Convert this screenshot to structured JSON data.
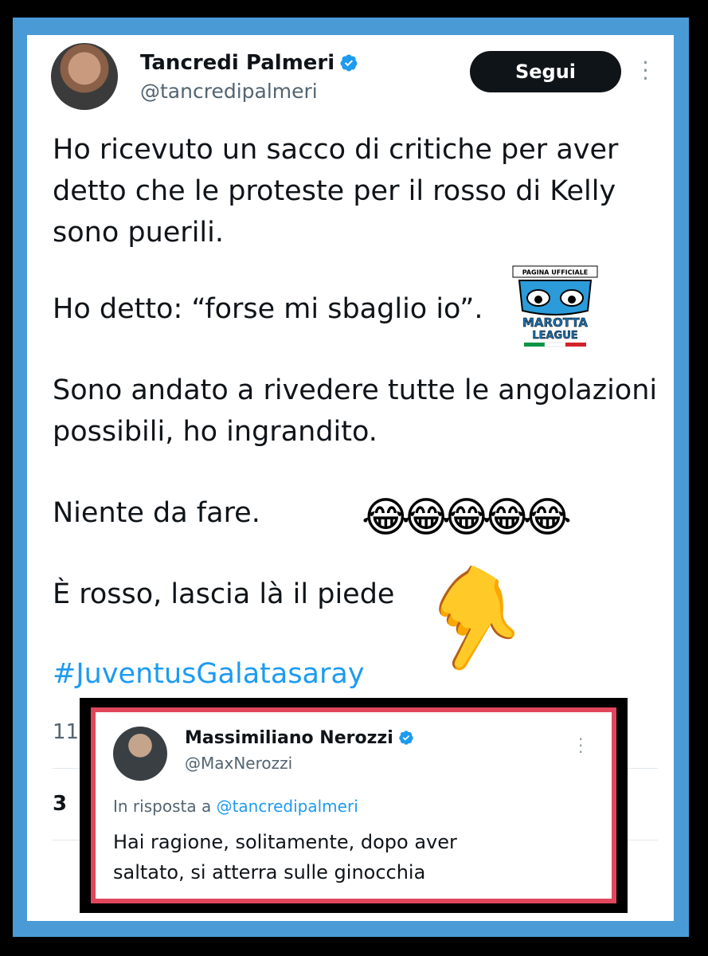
{
  "tweet": {
    "author_name": "Tancredi Palmeri",
    "author_handle": "@tancredipalmeri",
    "follow_label": "Segui",
    "lines": [
      "Ho ricevuto un sacco di critiche per aver",
      "detto che le proteste per il rosso di Kelly",
      "sono puerili.",
      "Ho detto: “forse mi sbaglio io”.",
      "Sono andato a rivedere tutte le angolazioni",
      "possibili, ho ingrandito.",
      "Niente da fare.",
      "È rosso, lascia là il piede"
    ],
    "hashtag": "#JuventusGalatasaray",
    "time_partial": "11:",
    "count_partial": "3"
  },
  "overlay_logo": {
    "top_text": "PAGINA UFFICIALE",
    "line1": "MAROTTA",
    "line2": "LEAGUE"
  },
  "reply": {
    "author_name": "Massimiliano Nerozzi",
    "author_handle": "@MaxNerozzi",
    "reply_prefix": "In risposta a",
    "reply_mention": "@tancredipalmeri",
    "lines": [
      "Hai ragione, solitamente, dopo aver",
      "saltato, si atterra sulle ginocchia"
    ]
  },
  "colors": {
    "frame": "#4a9ad6",
    "verified": "#1d9bf0",
    "hashtag": "#1d9bf0",
    "reply_border": "#e0475d"
  },
  "icons": {
    "verified": "verified-badge-icon",
    "more": "more-options-icon",
    "emoji_laugh": "😂",
    "emoji_point": "👇"
  }
}
